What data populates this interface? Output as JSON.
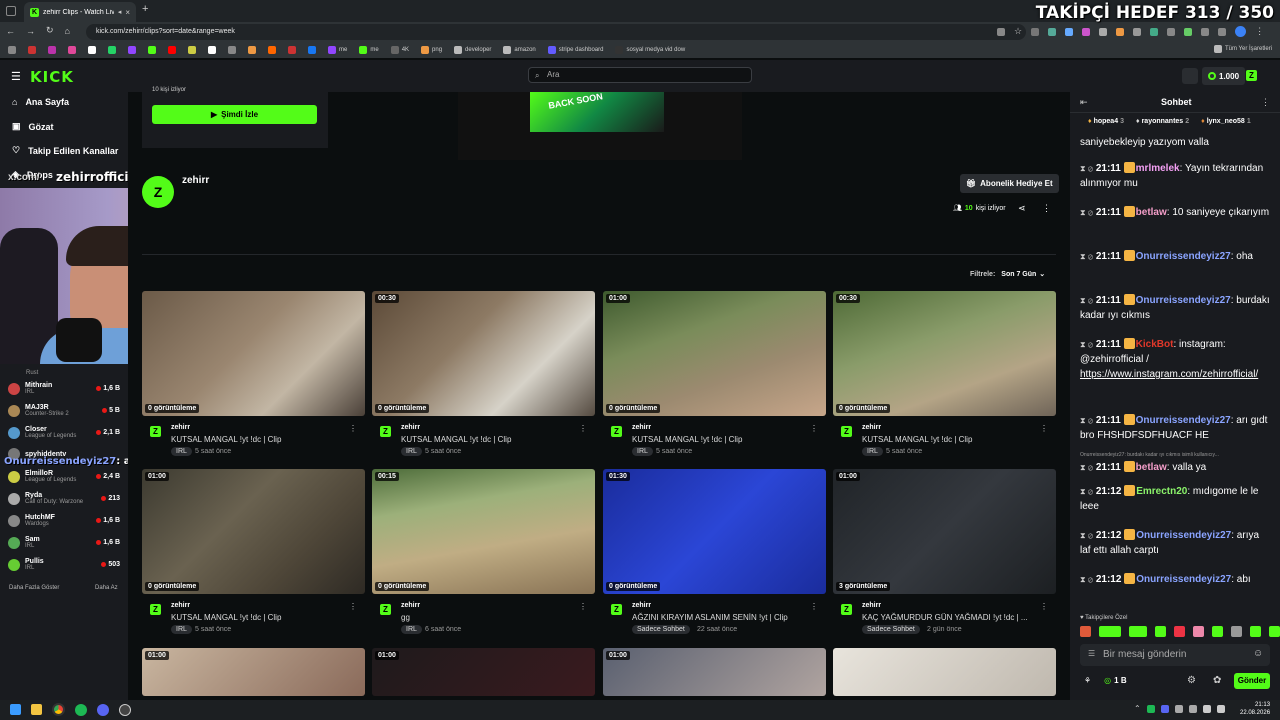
{
  "browser": {
    "tab_title": "zehirr Clips - Watch Live or...",
    "new_tab": "+",
    "url": "kick.com/zehirr/clips?sort=date&range=week",
    "bookmarks": [
      "me",
      "me",
      "4K",
      "png",
      "developer",
      "amazon",
      "stripe dashboard",
      "sosyal medya vid dow"
    ],
    "all_bookmarks": "Tüm Yer İşaretleri"
  },
  "overlay": {
    "follower_goal": "TAKİPÇİ HEDEF 313 / 350"
  },
  "header": {
    "logo": "KICK",
    "search_placeholder": "Ara",
    "balance": "1.000"
  },
  "sidebar": {
    "nav": [
      "Ana Sayfa",
      "Gözat",
      "Takip Edilen Kanallar",
      "Drops"
    ],
    "channels": [
      {
        "name": "Mithrain",
        "game": "IRL",
        "viewers": "1,6 B",
        "color": "#c44"
      },
      {
        "name": "MAJ3R",
        "game": "Counter-Strike 2",
        "viewers": "5 B",
        "color": "#a85"
      },
      {
        "name": "Closer",
        "game": "League of Legends",
        "viewers": "2,1 B",
        "color": "#59c"
      },
      {
        "name": "spyhiddentv",
        "game": "",
        "viewers": "",
        "color": "#777"
      },
      {
        "name": "ElmilloR",
        "game": "League of Legends",
        "viewers": "2,4 B",
        "color": "#cc4"
      },
      {
        "name": "Ryda",
        "game": "Call of Duty: Warzone",
        "viewers": "213",
        "color": "#aaa"
      },
      {
        "name": "HutchMF",
        "game": "Wardogs",
        "viewers": "1,6 B",
        "color": "#888"
      },
      {
        "name": "Sam",
        "game": "IRL",
        "viewers": "1,6 B",
        "color": "#5a5"
      },
      {
        "name": "Pullis",
        "game": "IRL",
        "viewers": "503",
        "color": "#6c3"
      }
    ],
    "show_more": "Daha Fazla Göster",
    "show_less": "Daha Az",
    "partial_channel": "Rust",
    "handle_overlay": "zehirrofficial",
    "x_handle": "x.com/",
    "chat_overlay_name": "Onurreissendeyiz27",
    "chat_overlay_text": ": abı"
  },
  "live": {
    "viewing": "10 kişi izliyor",
    "watch_button": "Şimdi İzle",
    "preview_text": "BACK SOON"
  },
  "channel": {
    "name": "zehirr",
    "gift_button": "Abonelik Hediye Et",
    "viewers": "10",
    "viewers_label": "kişi izliyor"
  },
  "filter": {
    "label": "Filtrele:",
    "value": "Son 7 Gün"
  },
  "clips": [
    {
      "duration": "",
      "views": "0 görüntüleme",
      "channel": "zehirr",
      "title": "KUTSAL MANGAL !yt !dc | Clip",
      "tag": "IRL",
      "time": "5 saat önce",
      "bg": "linear-gradient(135deg,#6b5a48,#9a8670 45%,#c2b6a4 70%,#4a4038)"
    },
    {
      "duration": "00:30",
      "views": "0 görüntüleme",
      "channel": "zehirr",
      "title": "KUTSAL MANGAL !yt !dc | Clip",
      "tag": "IRL",
      "time": "5 saat önce",
      "bg": "linear-gradient(135deg,#5c4a38,#8d7a64 40%,#d6d2c8 70%,#544a40)"
    },
    {
      "duration": "01:00",
      "views": "0 görüntüleme",
      "channel": "zehirr",
      "title": "KUTSAL MANGAL !yt !dc | Clip",
      "tag": "IRL",
      "time": "5 saat önce",
      "bg": "linear-gradient(160deg,#3e5a2e,#7a8c5a 35%,#9c8a70 65%,#c7a68a)"
    },
    {
      "duration": "00:30",
      "views": "0 görüntüleme",
      "channel": "zehirr",
      "title": "KUTSAL MANGAL !yt !dc | Clip",
      "tag": "IRL",
      "time": "5 saat önce",
      "bg": "linear-gradient(160deg,#4e6a36,#8a9c6a 40%,#b4a486 70%,#6f6458)"
    },
    {
      "duration": "01:00",
      "views": "0 görüntüleme",
      "channel": "zehirr",
      "title": "KUTSAL MANGAL !yt !dc | Clip",
      "tag": "IRL",
      "time": "5 saat önce",
      "bg": "linear-gradient(135deg,#3c3a30,#6a6250 40%,#4e4638 70%,#2e2a24)"
    },
    {
      "duration": "00:15",
      "views": "0 görüntüleme",
      "channel": "zehirr",
      "title": "gg",
      "tag": "IRL",
      "time": "6 saat önce",
      "bg": "linear-gradient(170deg,#4d6c3a,#9cb07a 30%,#c0ad84 60%,#8a7456)"
    },
    {
      "duration": "01:30",
      "views": "0 görüntüleme",
      "channel": "zehirr",
      "title": "AĞZINI KIRAYIM ASLANIM SENİN !yt | Clip",
      "tag": "Sadece Sohbet",
      "time": "22 saat önce",
      "bg": "linear-gradient(135deg,#1a2c9c,#2b46d6 50%,#1a2c9c)"
    },
    {
      "duration": "01:00",
      "views": "3 görüntüleme",
      "channel": "zehirr",
      "title": "KAÇ YAĞMURDUR GÜN YAĞMADI !yt !dc | ...",
      "tag": "Sadece Sohbet",
      "time": "2 gün önce",
      "bg": "linear-gradient(135deg,#202428,#34383e 50%,#1c1f22)"
    },
    {
      "duration": "01:00",
      "views": "",
      "channel": "",
      "title": "",
      "tag": "",
      "time": "",
      "bg": "linear-gradient(135deg,#c9b6a0,#8a6a5a)"
    },
    {
      "duration": "01:00",
      "views": "",
      "channel": "",
      "title": "",
      "tag": "",
      "time": "",
      "bg": "linear-gradient(135deg,#1e1a1c,#3a1a1e)"
    },
    {
      "duration": "01:00",
      "views": "",
      "channel": "",
      "title": "",
      "tag": "",
      "time": "",
      "bg": "linear-gradient(135deg,#5a6070,#b0a4a0)"
    },
    {
      "duration": "",
      "views": "",
      "channel": "",
      "title": "",
      "tag": "",
      "time": "",
      "bg": "linear-gradient(135deg,#e8e4dc,#bfb8ae)"
    }
  ],
  "chat": {
    "title": "Sohbet",
    "top_gifters": [
      {
        "name": "hopea4",
        "count": "3"
      },
      {
        "name": "rayonnantes",
        "count": "2"
      },
      {
        "name": "lynx_neo58",
        "count": "1"
      }
    ],
    "partial": "saniyebekleyip yazıyom valla",
    "messages": [
      {
        "time": "21:11",
        "user": "mrlmelek",
        "ucolor": "#f4a0f4",
        "text": " Yayın tekrarından alınmıyor mu"
      },
      {
        "time": "21:11",
        "user": "betlaw",
        "ucolor": "#f49ec9",
        "text": " 10 saniyeye çıkarıyım"
      },
      {
        "time": "21:11",
        "user": "Onurreissendeyiz27",
        "ucolor": "#8aa4ff",
        "text": " oha"
      },
      {
        "time": "21:11",
        "user": "Onurreissendeyiz27",
        "ucolor": "#8aa4ff",
        "text": " burdakı kadar ıyı cıkmıs"
      },
      {
        "time": "21:11",
        "user": "KickBot",
        "ucolor": "#e2382a",
        "text": " instagram: @zehirrofficial / "
      },
      {
        "time": "21:11",
        "user": "Onurreissendeyiz27",
        "ucolor": "#8aa4ff",
        "text": " arı gıdt bro FHSHDFSDFHUACF HE"
      },
      {
        "time": "21:11",
        "user": "betlaw",
        "ucolor": "#f49ec9",
        "text": " valla ya"
      },
      {
        "time": "21:12",
        "user": "Emrectn20",
        "ucolor": "#8cf56b",
        "text": " mıdıgome le le leee"
      },
      {
        "time": "21:12",
        "user": "Onurreissendeyiz27",
        "ucolor": "#8aa4ff",
        "text": " arıya laf ettı allah carptı"
      },
      {
        "time": "21:12",
        "user": "Onurreissendeyiz27",
        "ucolor": "#8aa4ff",
        "text": " abı"
      }
    ],
    "link": "https://www.instagram.com/zehirrofficial/",
    "reply_note": "Onurreissendeyiz27: burdakı kadar ıyı cıkmıs isimli kullanıcıy...",
    "subs_only": "Takipçilere Özel",
    "input_placeholder": "Bir mesaj gönderin",
    "points": "1 B",
    "send": "Gönder"
  },
  "taskbar": {
    "time": "21:13",
    "date": "22.08.2026"
  }
}
